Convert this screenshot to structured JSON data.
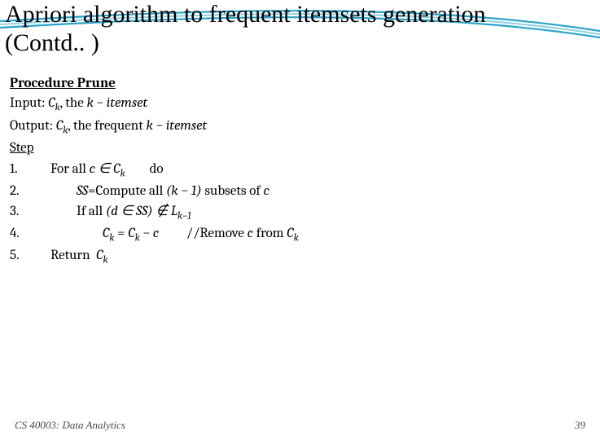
{
  "title_line1": "Apriori algorithm to frequent itemsets generation",
  "title_line2": "(Contd.. )",
  "procedure_heading": "Procedure Prune",
  "input_label": "Input:",
  "input_text_before": " C",
  "input_text_after": ", the ",
  "input_itemset": "k − itemset",
  "output_label": "Output:",
  "output_text_before": " C",
  "output_text_mid": ", the frequent ",
  "output_itemset": "k − itemset",
  "step_label": "Step",
  "steps": {
    "n1": "1.",
    "n2": "2.",
    "n3": "3.",
    "n4": "4.",
    "n5": "5."
  },
  "s1_a": "For all ",
  "s1_b": "c ∈ C",
  "s1_c": "        do",
  "s2_a": "SS",
  "s2_b": "=Compute all ",
  "s2_c": "(k − 1)",
  "s2_d": " subsets of ",
  "s2_e": "c",
  "s3_a": "If all ",
  "s3_b": "(d ∈ SS) ∉ L",
  "s4_a": "C",
  "s4_b": " = ",
  "s4_c": "C",
  "s4_d": " − c",
  "s4_comment": "         //Remove ",
  "s4_e": "c",
  "s4_f": " from ",
  "s4_g": "C",
  "s5_a": "Return  ",
  "s5_b": "C",
  "sub_k": "k",
  "sub_km1": "k−1",
  "footer_course": "CS 40003: Data Analytics",
  "footer_page": "39"
}
